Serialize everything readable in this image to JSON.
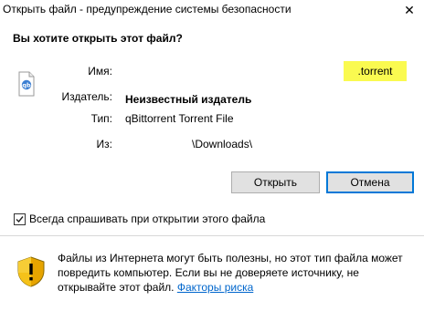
{
  "window": {
    "title": "Открыть файл - предупреждение системы безопасности",
    "close_glyph": "✕"
  },
  "dialog": {
    "question": "Вы хотите открыть этот файл?",
    "fields": {
      "name_label": "Имя:",
      "name_value": ".torrent",
      "publisher_label": "Издатель:",
      "publisher_value": "Неизвестный издатель",
      "type_label": "Тип:",
      "type_value": "qBittorrent Torrent File",
      "from_label": "Из:",
      "from_value": "\\Downloads\\"
    },
    "file_icon": "qbittorrent-file-icon"
  },
  "buttons": {
    "open_label": "Открыть",
    "cancel_label": "Отмена"
  },
  "checkbox": {
    "label": "Всегда спрашивать при открытии этого файла",
    "checked": true
  },
  "warning": {
    "icon": "security-shield-icon",
    "text": "Файлы из Интернета могут быть полезны, но этот тип файла может повредить компьютер. Если вы не доверяете источнику, не открывайте этот файл.",
    "link_label": "Факторы риска",
    "colors": {
      "link": "#0066cc",
      "highlight": "#fafa50",
      "accent": "#0078d7"
    }
  }
}
